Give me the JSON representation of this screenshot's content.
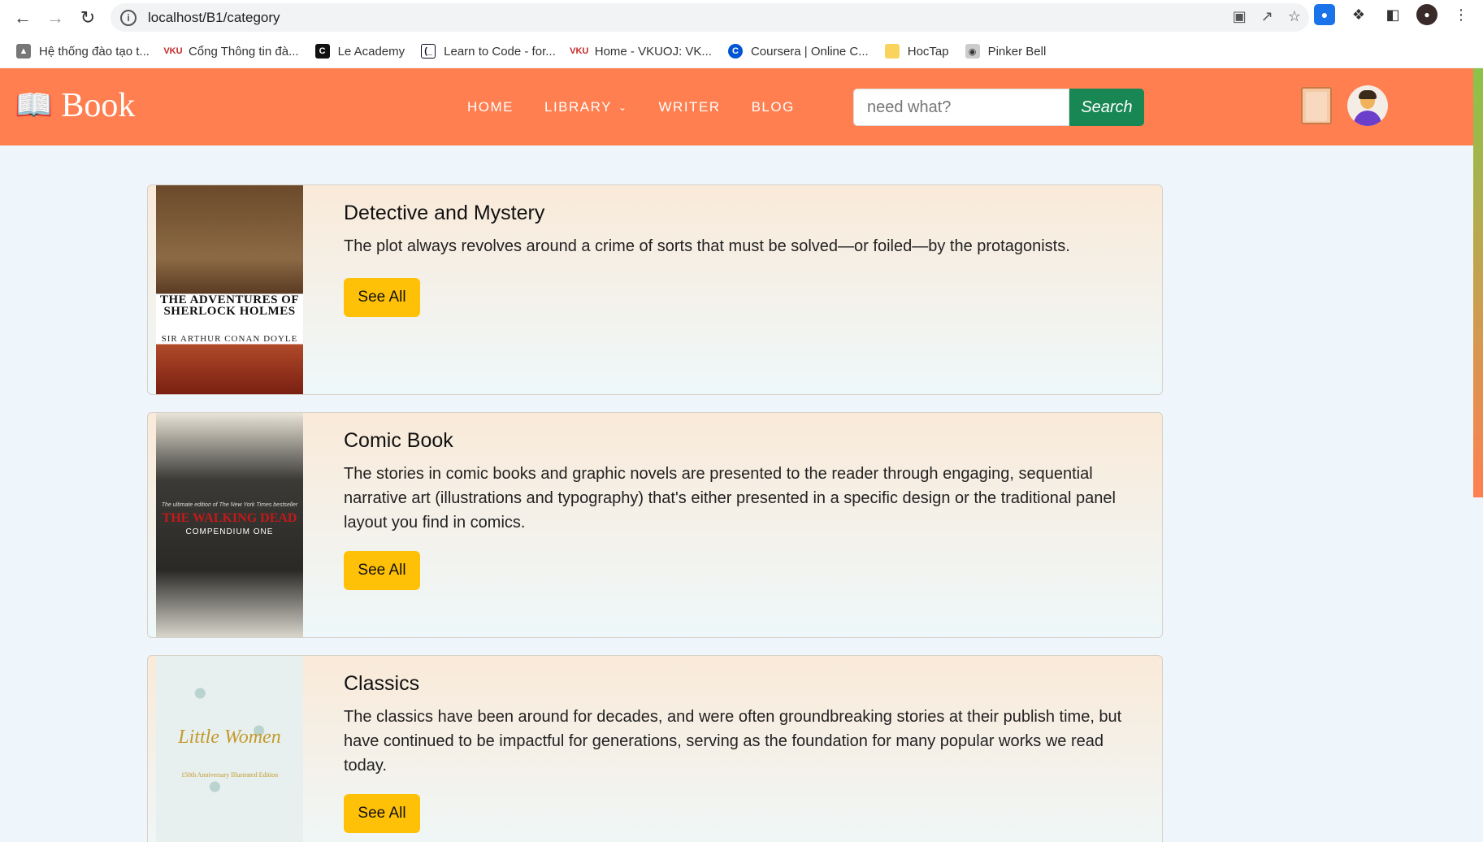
{
  "browser": {
    "url": "localhost/B1/category",
    "bookmarks": [
      {
        "label": "Hệ thống đào tạo t...",
        "icon": "school-icon",
        "color": "#555555"
      },
      {
        "label": "Cổng Thông tin đà...",
        "icon": "vku-icon",
        "color": "#c62828"
      },
      {
        "label": "Le Academy",
        "icon": "c-icon",
        "color": "#111111"
      },
      {
        "label": "Learn to Code - for...",
        "icon": "freecodecamp-icon",
        "color": "#0a0a23"
      },
      {
        "label": "Home - VKUOJ: VK...",
        "icon": "vku-icon",
        "color": "#c62828"
      },
      {
        "label": "Coursera | Online C...",
        "icon": "coursera-icon",
        "color": "#0056d2"
      },
      {
        "label": "HocTap",
        "icon": "folder-icon",
        "color": "#f9d35b"
      },
      {
        "label": "Pinker Bell",
        "icon": "bell-icon",
        "color": "#999999"
      }
    ]
  },
  "header": {
    "logo_text": "Book",
    "nav": [
      "HOME",
      "LIBRARY",
      "WRITER",
      "BLOG"
    ],
    "search_placeholder": "need what?",
    "search_button": "Search",
    "colors": {
      "header_bg": "#ff7f50",
      "search_button": "#198754",
      "see_all_button": "#ffc107"
    }
  },
  "categories": [
    {
      "title": "Detective and Mystery",
      "description": "The plot always revolves around a crime of sorts that must be solved—or foiled—by the protagonists.",
      "button": "See All",
      "cover": {
        "title": "THE ADVENTURES OF SHERLOCK HOLMES",
        "author": "SIR ARTHUR CONAN DOYLE"
      }
    },
    {
      "title": "Comic Book",
      "description": "The stories in comic books and graphic novels are presented to the reader through engaging, sequential narrative art (illustrations and typography) that's either presented in a specific design or the traditional panel layout you find in comics.",
      "button": "See All",
      "cover": {
        "top": "The ultimate edition of The New York Times bestseller",
        "title": "THE WALKING DEAD",
        "subtitle": "COMPENDIUM ONE"
      }
    },
    {
      "title": "Classics",
      "description": "The classics have been around for decades, and were often groundbreaking stories at their publish time, but have continued to be impactful for generations, serving as the foundation for many popular works we read today.",
      "button": "See All",
      "cover": {
        "title": "Little Women",
        "subtitle": "150th Anniversary Illustrated Edition"
      }
    }
  ]
}
